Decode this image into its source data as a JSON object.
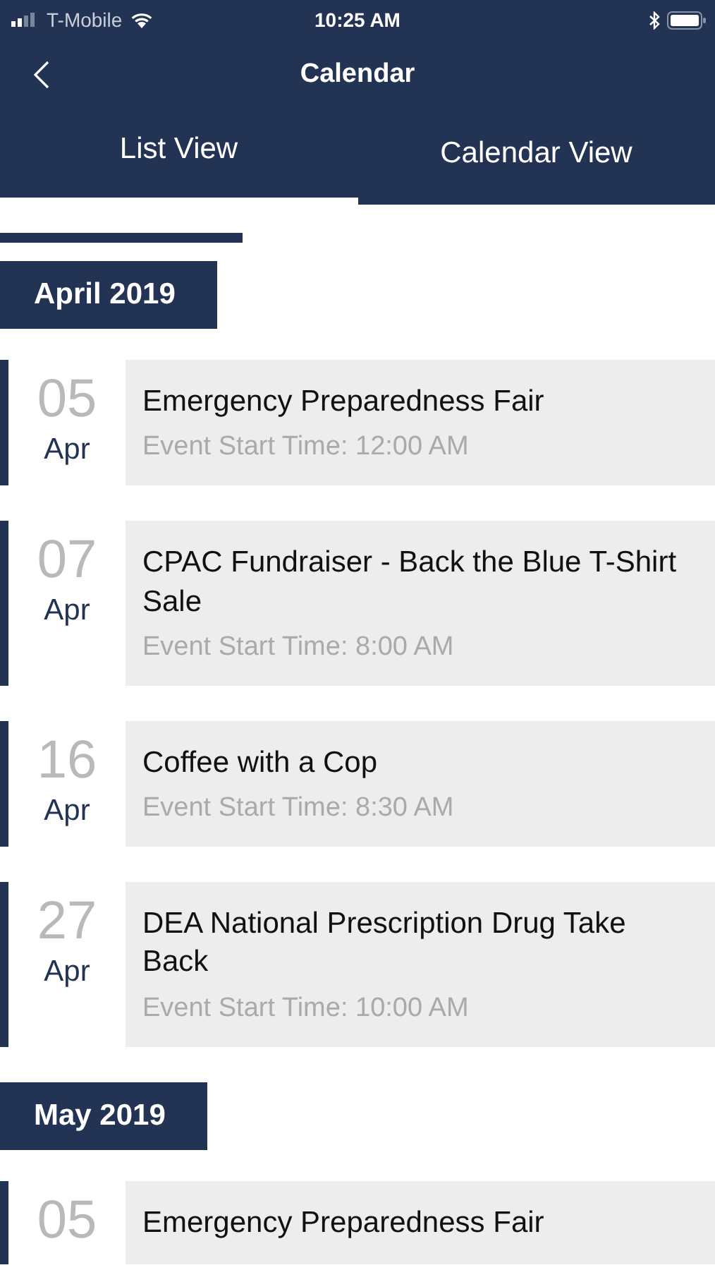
{
  "status_bar": {
    "carrier": "T-Mobile",
    "time": "10:25 AM"
  },
  "nav": {
    "title": "Calendar"
  },
  "tabs": [
    {
      "label": "List View",
      "selected": true
    },
    {
      "label": "Calendar View",
      "selected": false
    }
  ],
  "months": [
    {
      "label": "April 2019",
      "events": [
        {
          "day": "05",
          "month": "Apr",
          "title": "Emergency Preparedness Fair",
          "time": "Event Start Time: 12:00 AM"
        },
        {
          "day": "07",
          "month": "Apr",
          "title": "CPAC Fundraiser - Back the Blue T-Shirt Sale",
          "time": "Event Start Time: 8:00 AM"
        },
        {
          "day": "16",
          "month": "Apr",
          "title": "Coffee with a Cop",
          "time": "Event Start Time: 8:30 AM"
        },
        {
          "day": "27",
          "month": "Apr",
          "title": "DEA National Prescription Drug Take Back",
          "time": "Event Start Time: 10:00 AM"
        }
      ]
    },
    {
      "label": "May 2019",
      "events": [
        {
          "day": "05",
          "title": "Emergency Preparedness Fair"
        }
      ]
    }
  ]
}
